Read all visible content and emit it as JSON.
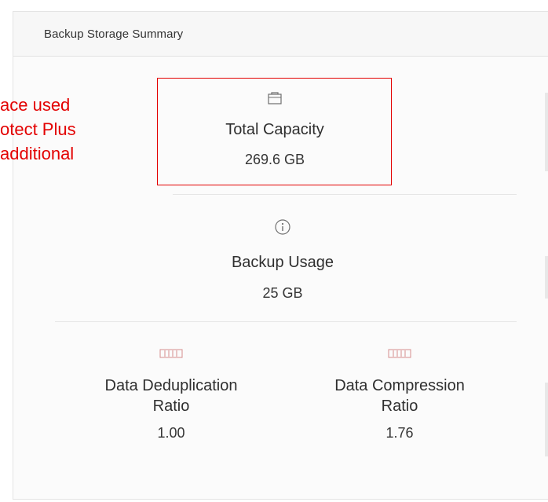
{
  "panel": {
    "title": "Backup Storage Summary"
  },
  "callout": {
    "text": "ace used\notect Plus\nadditional"
  },
  "metrics": [
    {
      "label": "Total Capacity",
      "value": "269.6 GB",
      "icon": "folder-icon"
    },
    {
      "label": "Backup Usage",
      "value": "25 GB",
      "icon": "info-icon"
    },
    {
      "label": "Data Deduplication\nRatio",
      "value": "1.00",
      "icon": "ratio-icon"
    },
    {
      "label": "Data Compression\nRatio",
      "value": "1.76",
      "icon": "ratio-icon"
    }
  ],
  "colors": {
    "callout": "#e30000",
    "ratio_icon": "#d58e8e"
  }
}
